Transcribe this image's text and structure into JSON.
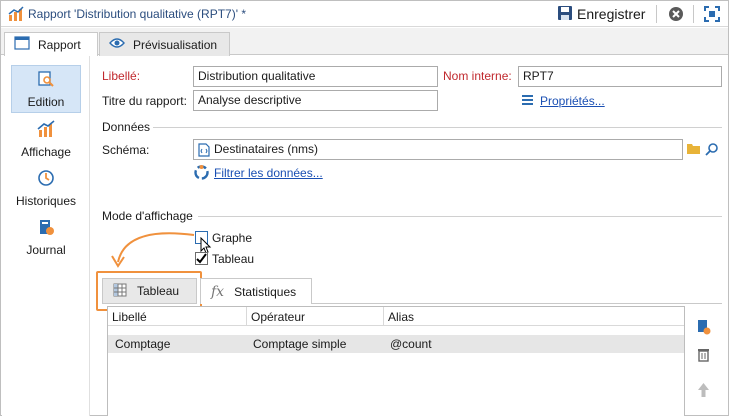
{
  "window": {
    "title": "Rapport 'Distribution qualitative (RPT7)' *",
    "save_label": "Enregistrer"
  },
  "tabs": [
    {
      "label": "Rapport"
    },
    {
      "label": "Prévisualisation"
    }
  ],
  "nav": [
    {
      "label": "Edition"
    },
    {
      "label": "Affichage"
    },
    {
      "label": "Historiques"
    },
    {
      "label": "Journal"
    }
  ],
  "form": {
    "libelle_label": "Libellé:",
    "libelle_value": "Distribution qualitative",
    "nom_interne_label": "Nom interne:",
    "nom_interne_value": "RPT7",
    "titre_label": "Titre du rapport:",
    "titre_value": "Analyse descriptive",
    "proprietes_link": "Propriétés...",
    "donnees_section": "Données",
    "schema_label": "Schéma:",
    "schema_value": "Destinataires (nms)",
    "filtrer_link": "Filtrer les données...",
    "mode_section": "Mode d'affichage",
    "graphe_label": "Graphe",
    "graphe_checked": false,
    "tableau_label": "Tableau",
    "tableau_checked": true
  },
  "subtabs": [
    {
      "label": "Tableau"
    },
    {
      "label": "Statistiques"
    }
  ],
  "fx_glyph": "fx",
  "table": {
    "columns": [
      "Libellé",
      "Opérateur",
      "Alias"
    ],
    "rows": [
      [
        "Comptage",
        "Comptage simple",
        "@count"
      ]
    ]
  },
  "colors": {
    "accent_orange": "#f0913d",
    "selected_nav": "#d6e6f7",
    "required_label": "#c0282d",
    "link": "#1a4fb3"
  }
}
